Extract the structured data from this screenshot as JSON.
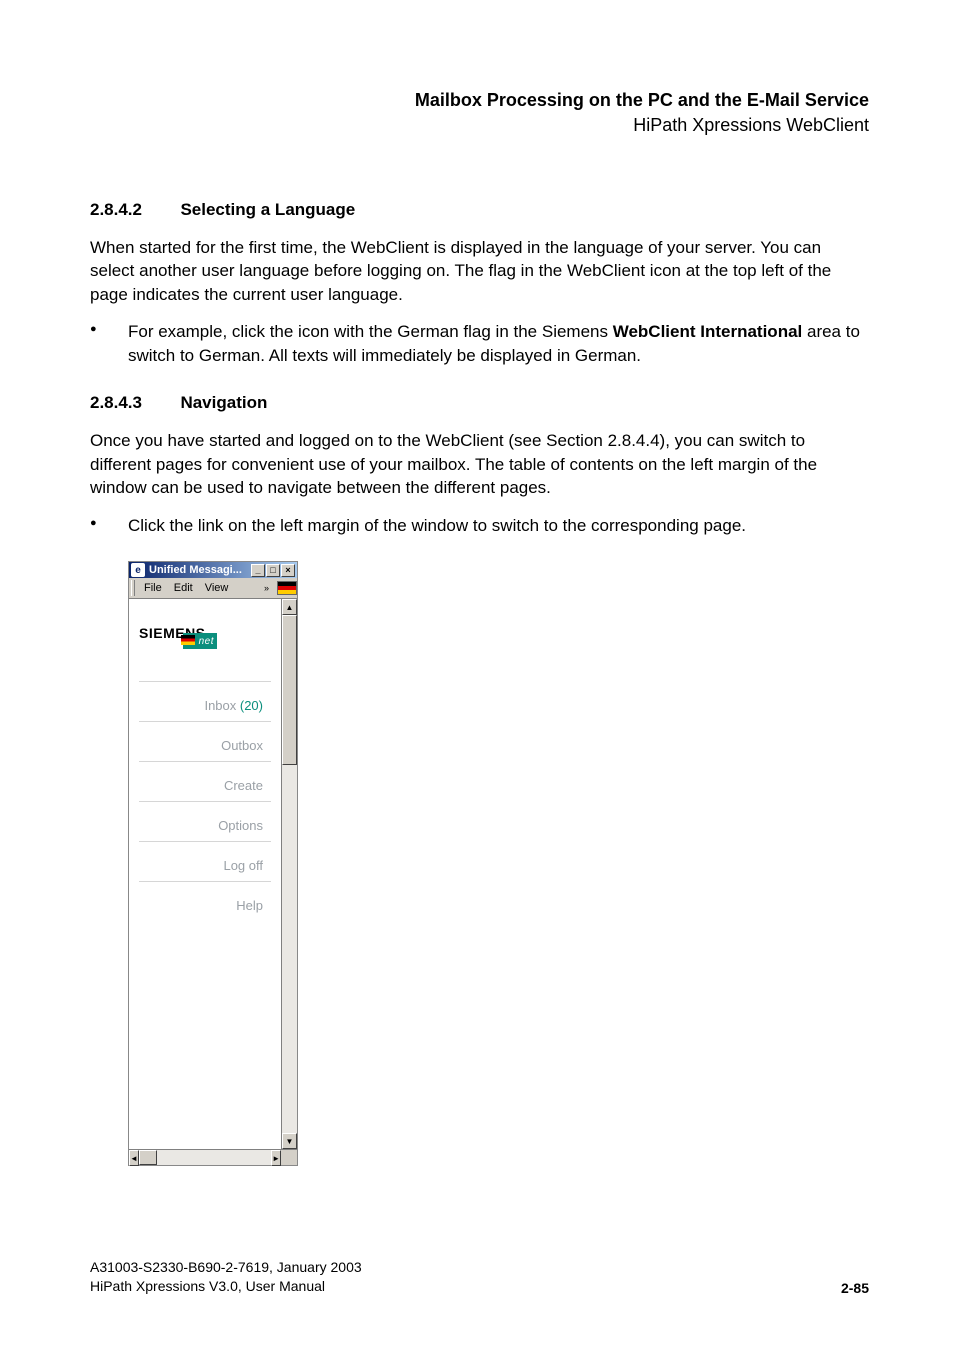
{
  "header": {
    "title": "Mailbox Processing on the PC and the E-Mail Service",
    "subtitle": "HiPath Xpressions WebClient"
  },
  "section1": {
    "num": "2.8.4.2",
    "title": "Selecting a Language",
    "p1": "When started for the first time, the WebClient is displayed in the language of your server. You can select another user language before logging on. The flag in the WebClient icon at the top left of the page indicates the current user language.",
    "b1_pre": "For example, click the icon with the German flag in the Siemens ",
    "b1_bold": "WebClient International",
    "b1_post": " area to switch to German. All texts will immediately be displayed in German."
  },
  "section2": {
    "num": "2.8.4.3",
    "title": "Navigation",
    "p1": "Once you have started and logged on to the WebClient (see Section 2.8.4.4), you can switch to different pages for convenient use of your mailbox. The table of contents on the left margin of the window can be used to navigate between the different pages.",
    "b1": "Click the link on the left margin of the window to switch to the corresponding page."
  },
  "embedded": {
    "window_title": "Unified Messagi...",
    "menu": {
      "file": "File",
      "edit": "Edit",
      "view": "View"
    },
    "logo_text": "SIEMENS",
    "logo_net": "net",
    "nav": {
      "inbox_label": "Inbox ",
      "inbox_count": "(20)",
      "outbox": "Outbox",
      "create": "Create",
      "options": "Options",
      "logoff": "Log off",
      "help": "Help"
    }
  },
  "footer": {
    "line1": "A31003-S2330-B690-2-7619, January 2003",
    "line2": "HiPath Xpressions V3.0, User Manual",
    "page": "2-85"
  }
}
